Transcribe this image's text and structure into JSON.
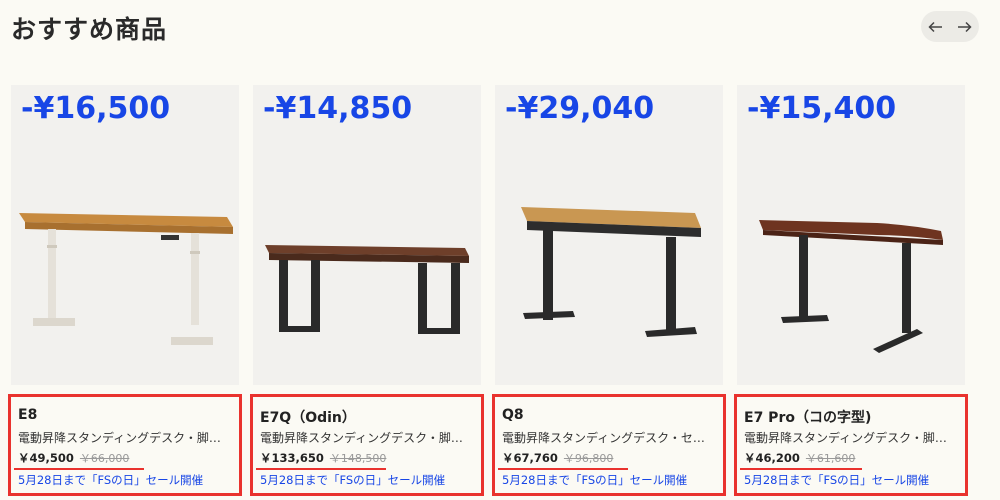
{
  "section_title": "おすすめ商品",
  "nav": {
    "prev_icon": "arrow-left-icon",
    "next_icon": "arrow-right-icon"
  },
  "products": [
    {
      "discount": "-¥16,500",
      "name": "E8",
      "desc": "電動昇降スタンディングデスク・脚…",
      "price": "￥49,500",
      "old_price": "￥66,000",
      "sale": "5月28日まで「FSの日」セール開催"
    },
    {
      "discount": "-¥14,850",
      "name": "E7Q（Odin）",
      "desc": "電動昇降スタンディングデスク・脚…",
      "price": "￥133,650",
      "old_price": "￥148,500",
      "sale": "5月28日まで「FSの日」セール開催"
    },
    {
      "discount": "-¥29,040",
      "name": "Q8",
      "desc": "電動昇降スタンディングデスク・セ…",
      "price": "￥67,760",
      "old_price": "￥96,800",
      "sale": "5月28日まで「FSの日」セール開催"
    },
    {
      "discount": "-¥15,400",
      "name": "E7 Pro（コの字型)",
      "desc": "電動昇降スタンディングデスク・脚…",
      "price": "￥46,200",
      "old_price": "￥61,600",
      "sale": "5月28日まで「FSの日」セール開催"
    }
  ]
}
